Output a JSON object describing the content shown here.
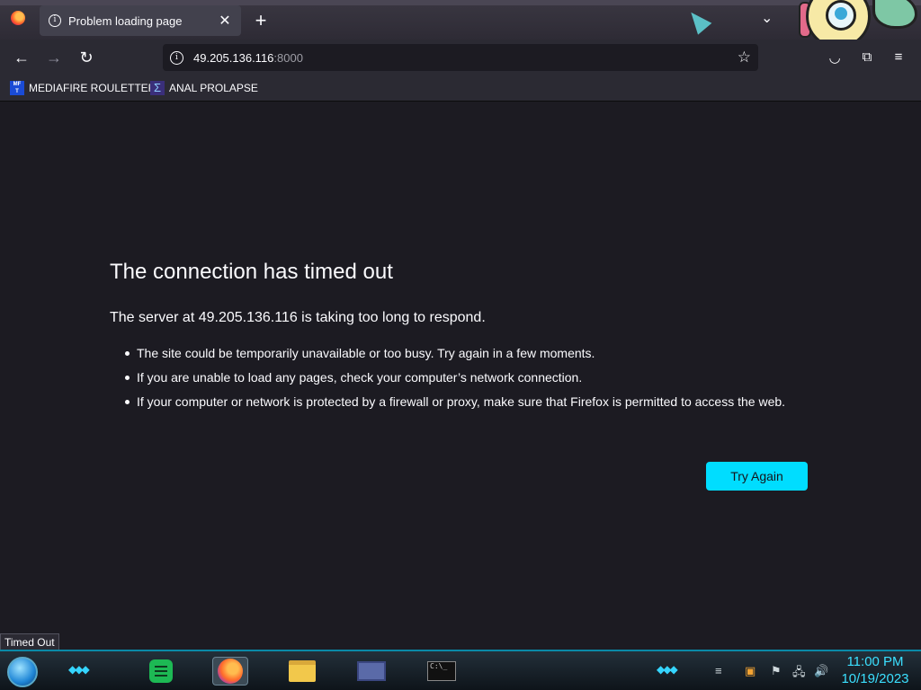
{
  "browser": {
    "tab": {
      "title": "Problem loading page"
    },
    "url": {
      "host": "49.205.136.116",
      "port": ":8000"
    },
    "bookmarks": [
      {
        "label": "MEDIAFIRE ROULETTER",
        "icon": "mediafire-icon",
        "icon_text": "MF\nT"
      },
      {
        "label": "ANAL PROLAPSE",
        "icon": "sigma-bookmark-icon",
        "icon_text": "Σ"
      }
    ]
  },
  "error": {
    "title": "The connection has timed out",
    "subtitle": "The server at 49.205.136.116 is taking too long to respond.",
    "bullets": [
      "The site could be temporarily unavailable or too busy. Try again in a few moments.",
      "If you are unable to load any pages, check your computer’s network connection.",
      "If your computer or network is protected by a firewall or proxy, make sure that Firefox is permitted to access the web."
    ],
    "button": "Try Again"
  },
  "status_text": "Timed Out",
  "taskbar": {
    "apps": [
      "spotify-icon",
      "firefox-icon",
      "file-explorer-icon",
      "control-panel-icon",
      "command-prompt-icon"
    ],
    "cmd_label": "C:\\_",
    "time": "11:00 PM",
    "date": "10/19/2023"
  },
  "colors": {
    "page_bg": "#1c1b22",
    "toolbar_bg": "#2b2a33",
    "accent_button": "#00ddff",
    "clock": "#3be0ff"
  }
}
